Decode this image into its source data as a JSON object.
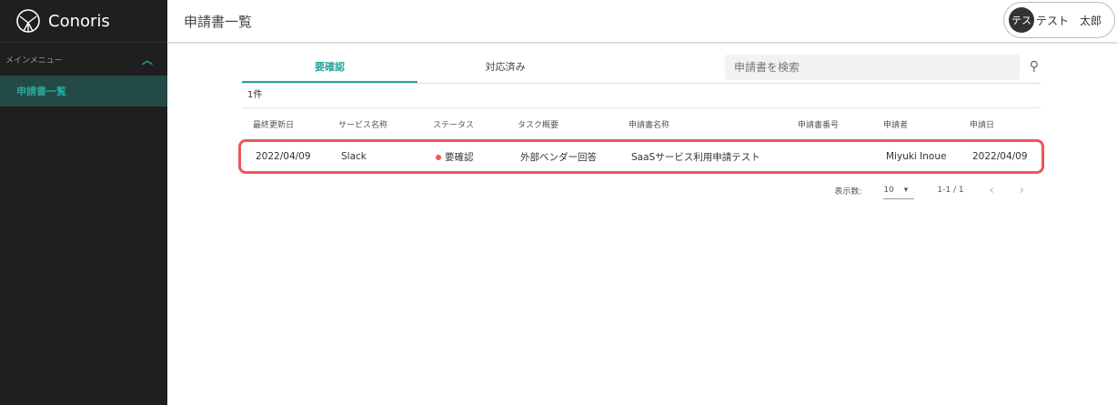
{
  "sidebar": {
    "logo": "Conoris",
    "menu_header": "メインメニュー",
    "items": [
      {
        "label": "申請書一覧"
      }
    ]
  },
  "header": {
    "title": "申請書一覧",
    "user": {
      "avatar": "テス",
      "name": "テスト　太郎"
    }
  },
  "tabs": [
    {
      "label": "要確認",
      "active": true
    },
    {
      "label": "対応済み",
      "active": false
    }
  ],
  "search": {
    "placeholder": "申請書を検索"
  },
  "count": "1件",
  "table": {
    "columns": [
      "最終更新日",
      "サービス名称",
      "ステータス",
      "タスク概要",
      "申請書名称",
      "申請書番号",
      "申請者",
      "申請日"
    ],
    "rows": [
      [
        "2022/04/09",
        "Slack",
        "要確認",
        "外部ベンダー回答",
        "SaaSサービス利用申請テスト",
        "",
        "Miyuki Inoue",
        "2022/04/09"
      ]
    ]
  },
  "pagination": {
    "per_page_label": "表示数:",
    "per_page": "10",
    "range": "1-1 / 1"
  },
  "colors": {
    "accent": "#26a69a",
    "highlight": "#f0555a"
  }
}
